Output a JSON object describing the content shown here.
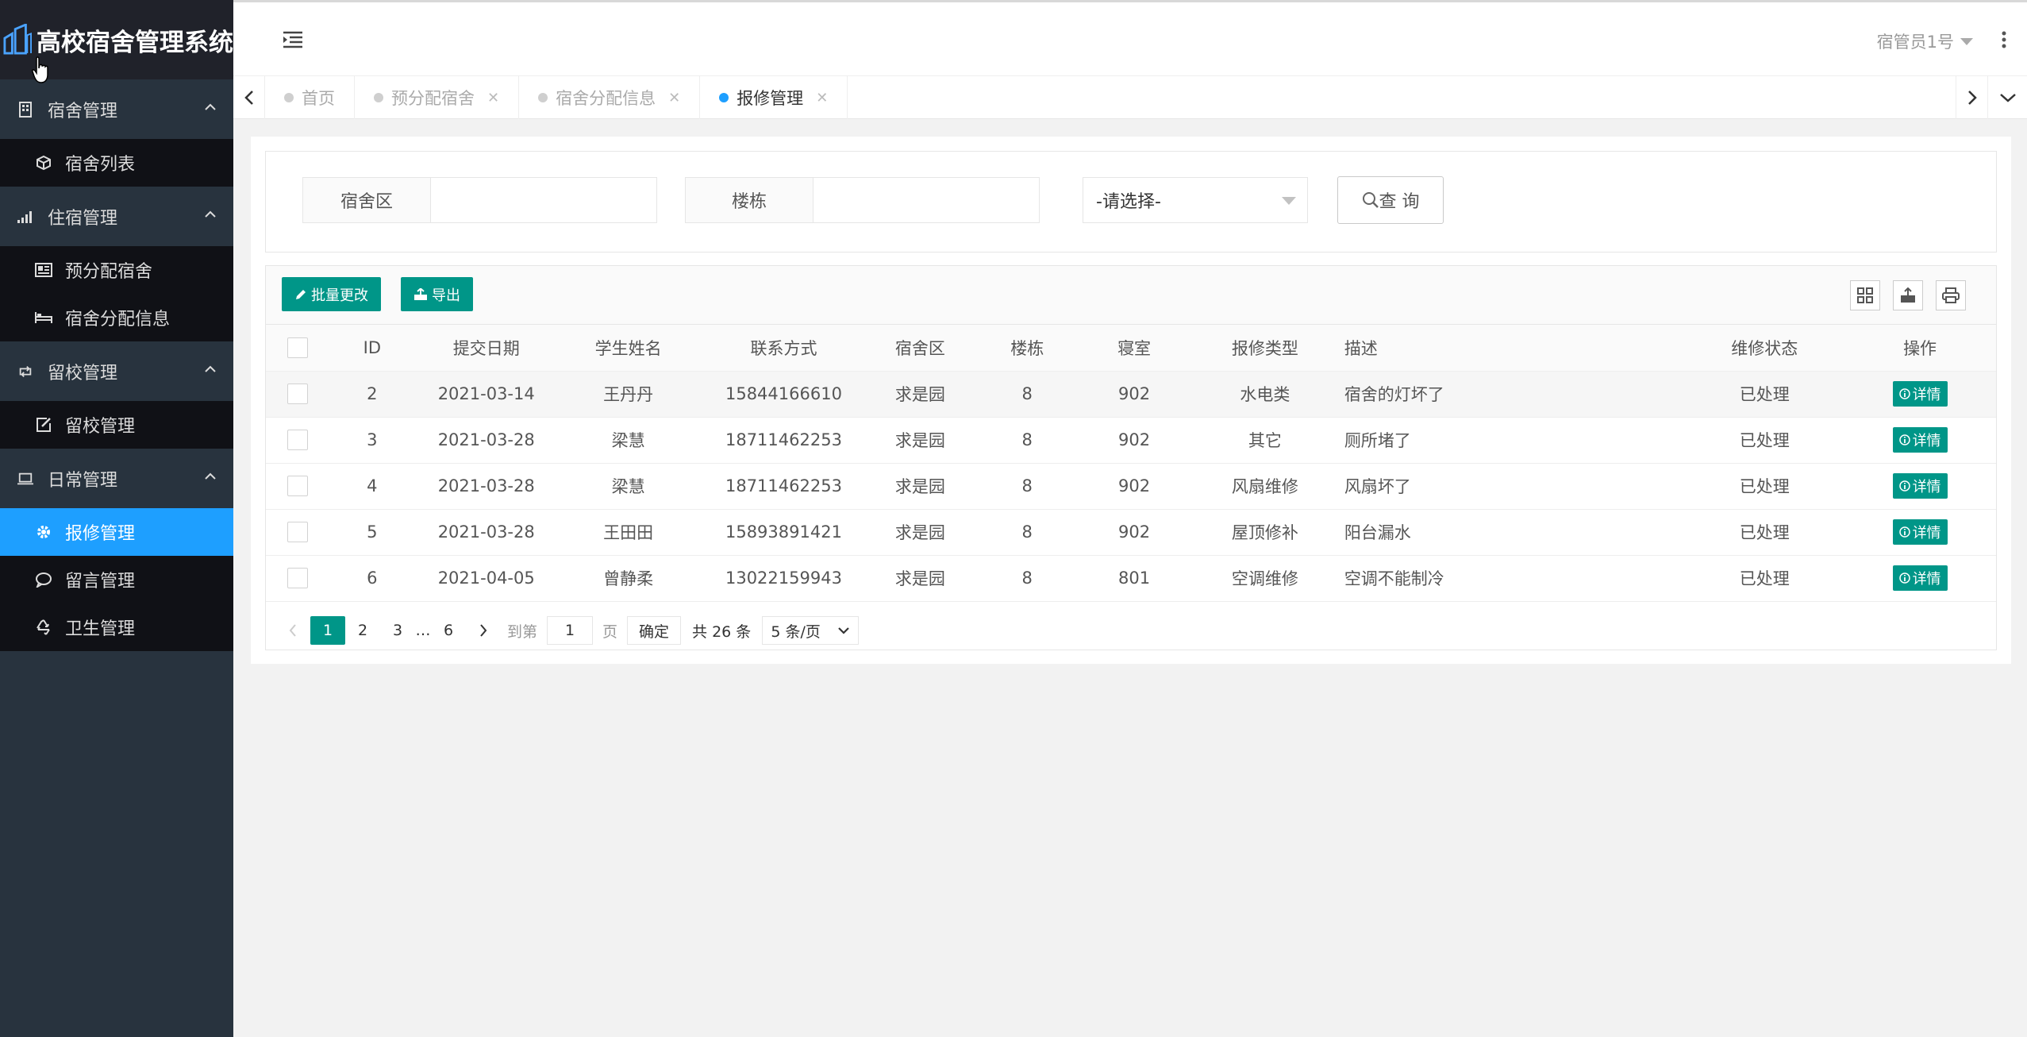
{
  "app": {
    "title": "高校宿舍管理系统"
  },
  "sidebar": {
    "groups": [
      {
        "label": "宿舍管理",
        "items": [
          {
            "label": "宿舍列表"
          }
        ]
      },
      {
        "label": "住宿管理",
        "items": [
          {
            "label": "预分配宿舍"
          },
          {
            "label": "宿舍分配信息"
          }
        ]
      },
      {
        "label": "留校管理",
        "items": [
          {
            "label": "留校管理"
          }
        ]
      },
      {
        "label": "日常管理",
        "items": [
          {
            "label": "报修管理"
          },
          {
            "label": "留言管理"
          },
          {
            "label": "卫生管理"
          }
        ]
      }
    ],
    "active_item": "报修管理"
  },
  "header": {
    "user": "宿管员1号"
  },
  "tabs": [
    {
      "label": "首页",
      "closable": false,
      "active": false
    },
    {
      "label": "预分配宿舍",
      "closable": true,
      "active": false
    },
    {
      "label": "宿舍分配信息",
      "closable": true,
      "active": false
    },
    {
      "label": "报修管理",
      "closable": true,
      "active": true
    }
  ],
  "filter": {
    "area_label": "宿舍区",
    "area_value": "",
    "building_label": "楼栋",
    "building_value": "",
    "select_value": "-请选择-",
    "query_label": "查 询"
  },
  "toolbar": {
    "batch_label": "批量更改",
    "export_label": "导出"
  },
  "table": {
    "columns": [
      "ID",
      "提交日期",
      "学生姓名",
      "联系方式",
      "宿舍区",
      "楼栋",
      "寝室",
      "报修类型",
      "描述",
      "维修状态",
      "操作"
    ],
    "rows": [
      {
        "id": "2",
        "date": "2021-03-14",
        "name": "王丹丹",
        "phone": "15844166610",
        "area": "求是园",
        "building": "8",
        "room": "902",
        "type": "水电类",
        "desc": "宿舍的灯坏了",
        "status": "已处理",
        "action": "详情"
      },
      {
        "id": "3",
        "date": "2021-03-28",
        "name": "梁慧",
        "phone": "18711462253",
        "area": "求是园",
        "building": "8",
        "room": "902",
        "type": "其它",
        "desc": "厕所堵了",
        "status": "已处理",
        "action": "详情"
      },
      {
        "id": "4",
        "date": "2021-03-28",
        "name": "梁慧",
        "phone": "18711462253",
        "area": "求是园",
        "building": "8",
        "room": "902",
        "type": "风扇维修",
        "desc": "风扇坏了",
        "status": "已处理",
        "action": "详情"
      },
      {
        "id": "5",
        "date": "2021-03-28",
        "name": "王田田",
        "phone": "15893891421",
        "area": "求是园",
        "building": "8",
        "room": "902",
        "type": "屋顶修补",
        "desc": "阳台漏水",
        "status": "已处理",
        "action": "详情"
      },
      {
        "id": "6",
        "date": "2021-04-05",
        "name": "曾静柔",
        "phone": "13022159943",
        "area": "求是园",
        "building": "8",
        "room": "801",
        "type": "空调维修",
        "desc": "空调不能制冷",
        "status": "已处理",
        "action": "详情"
      }
    ]
  },
  "pager": {
    "pages": [
      "1",
      "2",
      "3"
    ],
    "ellipsis": "…",
    "last_page": "6",
    "current": "1",
    "goto_label": "到第",
    "goto_value": "1",
    "page_unit": "页",
    "confirm_label": "确定",
    "total_label": "共 26 条",
    "page_size": "5 条/页"
  },
  "colors": {
    "accent": "#009688",
    "active_blue": "#1e9fff",
    "sidebar": "#28333e"
  }
}
